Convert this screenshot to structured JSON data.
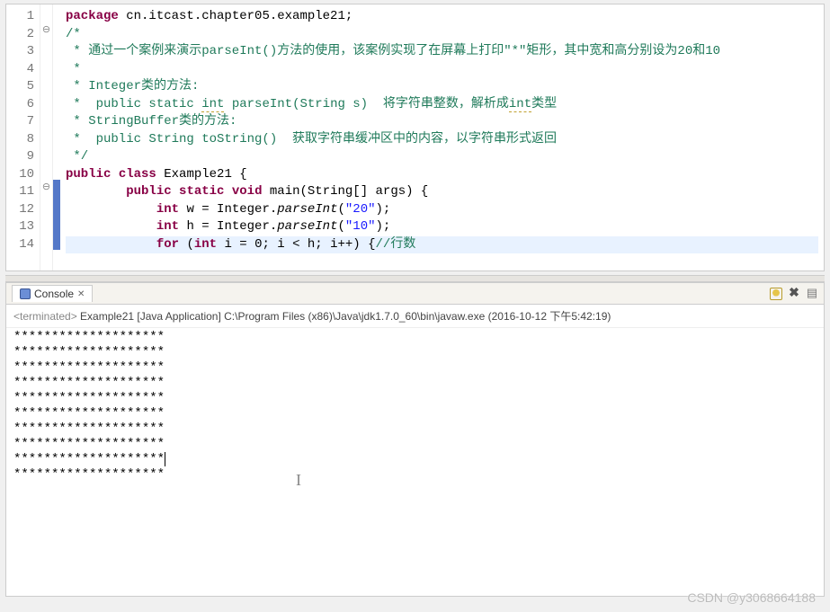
{
  "editor": {
    "lines": {
      "l1": {
        "num": "1",
        "pkg": "package",
        "pkgname": "cn.itcast.chapter05.example21",
        "semi": ";"
      },
      "l2": {
        "num": "2",
        "fold": "⊖",
        "text": "/*"
      },
      "l3": {
        "num": "3",
        "text": " * 通过一个案例来演示parseInt()方法的使用，该案例实现了在屏幕上打印\"*\"矩形，其中宽和高分别设为20和10"
      },
      "l4": {
        "num": "4",
        "text": " *"
      },
      "l5": {
        "num": "5",
        "text": " * Integer类的方法:"
      },
      "l6": {
        "num": "6",
        "pre": " *  public static ",
        "intw": "int",
        "mid": " parseInt(String s)  将字符串整数，解析成",
        "intw2": "int",
        "post": "类型"
      },
      "l7": {
        "num": "7",
        "text": " * StringBuffer类的方法:"
      },
      "l8": {
        "num": "8",
        "text": " *  public String toString()  获取字符串缓冲区中的内容，以字符串形式返回"
      },
      "l9": {
        "num": "9",
        "text": " */"
      },
      "l10": {
        "num": "10",
        "kw1": "public",
        "kw2": "class",
        "cls": "Example21",
        "brace": " {"
      },
      "l11": {
        "num": "11",
        "fold": "⊖",
        "indent": "        ",
        "kw1": "public",
        "kw2": "static",
        "kw3": "void",
        "m": "main",
        "args": "(String[] args) {"
      },
      "l12": {
        "num": "12",
        "indent": "            ",
        "kw": "int",
        "v": " w = Integer.",
        "it": "parseInt",
        "s": "\"20\"",
        "end": ");"
      },
      "l13": {
        "num": "13",
        "indent": "            ",
        "kw": "int",
        "v": " h = Integer.",
        "it": "parseInt",
        "s": "\"10\"",
        "end": ");"
      },
      "l14": {
        "num": "14",
        "indent": "            ",
        "kw": "for",
        "paren": " (",
        "kw2": "int",
        "body": " i = 0; i < h; i++) {",
        "cm": "//行数"
      }
    }
  },
  "console": {
    "tab_label": "Console",
    "status_prefix": "<terminated> ",
    "status": "Example21 [Java Application] C:\\Program Files (x86)\\Java\\jdk1.7.0_60\\bin\\javaw.exe (2016-10-12 下午5:42:19)",
    "row": "********************",
    "rows_count": 10
  },
  "watermark": "CSDN @y3068664188",
  "chart_data": {
    "type": "table",
    "title": "Program output: 10 rows × 20 asterisks rectangle",
    "rows": 10,
    "cols": 20,
    "char": "*"
  }
}
